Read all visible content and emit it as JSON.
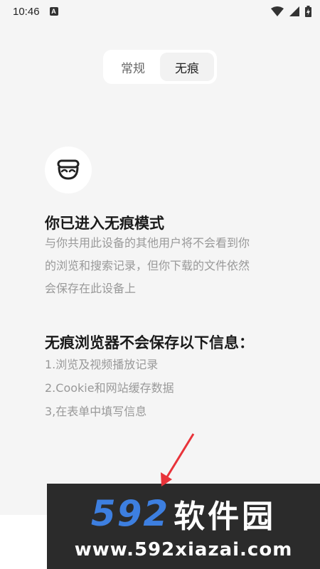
{
  "status_bar": {
    "time": "10:46",
    "notification_icon": "A"
  },
  "tabs": [
    {
      "label": "常规",
      "active": false
    },
    {
      "label": "无痕",
      "active": true
    }
  ],
  "incognito": {
    "icon": "incognito-mask-icon",
    "title": "你已进入无痕模式",
    "description_lines": [
      "与你共用此设备的其他用户将不会看到你",
      "的浏览和搜索记录，但你下载的文件依然",
      "会保存在此设备上"
    ]
  },
  "not_saved": {
    "title": "无痕浏览器不会保存以下信息：",
    "items": [
      "1.浏览及视频播放记录",
      "2.Cookie和网站缓存数据",
      "3,在表单中填写信息"
    ]
  },
  "watermark": {
    "number": "592",
    "name": "软件园",
    "url": "www.592xiazai.com"
  },
  "colors": {
    "background": "#f5f5f5",
    "annotation_arrow": "#e8333a",
    "watermark_blue": "#3d7fe0"
  }
}
